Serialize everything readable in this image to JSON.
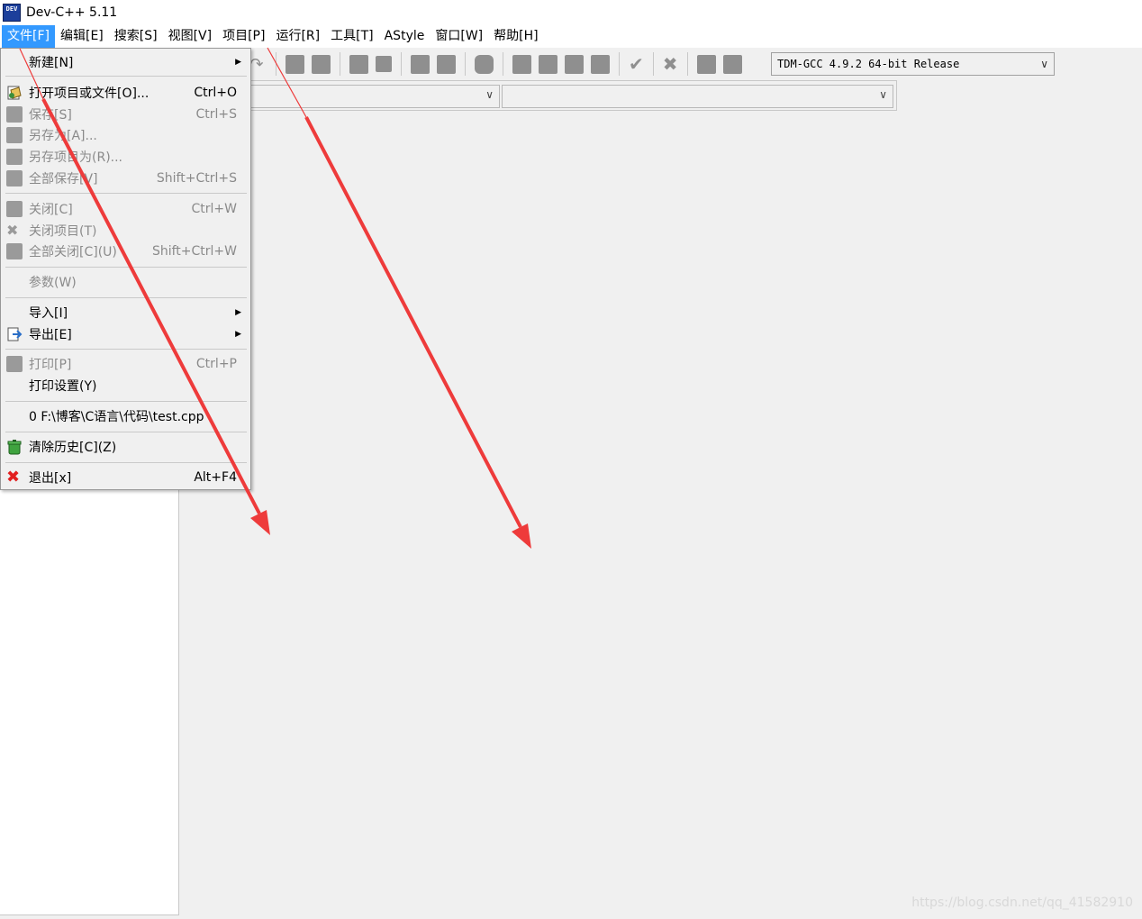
{
  "window": {
    "title": "Dev-C++ 5.11",
    "icon_text": "DEV"
  },
  "menubar": {
    "items": [
      {
        "label": "文件[F]",
        "active": true
      },
      {
        "label": "编辑[E]"
      },
      {
        "label": "搜索[S]"
      },
      {
        "label": "视图[V]"
      },
      {
        "label": "项目[P]"
      },
      {
        "label": "运行[R]"
      },
      {
        "label": "工具[T]"
      },
      {
        "label": "AStyle"
      },
      {
        "label": "窗口[W]"
      },
      {
        "label": "帮助[H]"
      }
    ]
  },
  "toolbar": {
    "compiler": "TDM-GCC 4.9.2 64-bit Release"
  },
  "file_menu": {
    "items": [
      {
        "label": "新建[N]",
        "shortcut": "",
        "submenu": true,
        "disabled": false,
        "icon": ""
      },
      {
        "label": "打开项目或文件[O]...",
        "shortcut": "Ctrl+O",
        "disabled": false,
        "icon": "open-icon"
      },
      {
        "label": "保存[S]",
        "shortcut": "Ctrl+S",
        "disabled": true,
        "icon": "save-icon"
      },
      {
        "label": "另存为[A]...",
        "shortcut": "",
        "disabled": true,
        "icon": "save-as-icon"
      },
      {
        "label": "另存项目为(R)...",
        "shortcut": "",
        "disabled": true,
        "icon": "save-project-icon"
      },
      {
        "label": "全部保存[V]",
        "shortcut": "Shift+Ctrl+S",
        "disabled": true,
        "icon": "save-all-icon"
      },
      {
        "label": "关闭[C]",
        "shortcut": "Ctrl+W",
        "disabled": true,
        "icon": "close-file-icon"
      },
      {
        "label": "关闭项目(T)",
        "shortcut": "",
        "disabled": true,
        "icon": "close-project-icon"
      },
      {
        "label": "全部关闭[C](U)",
        "shortcut": "Shift+Ctrl+W",
        "disabled": true,
        "icon": "close-all-icon"
      },
      {
        "label": "参数(W)",
        "shortcut": "",
        "disabled": true,
        "icon": ""
      },
      {
        "label": "导入[I]",
        "shortcut": "",
        "submenu": true,
        "disabled": false,
        "icon": ""
      },
      {
        "label": "导出[E]",
        "shortcut": "",
        "submenu": true,
        "disabled": false,
        "icon": "export-icon"
      },
      {
        "label": "打印[P]",
        "shortcut": "Ctrl+P",
        "disabled": true,
        "icon": "print-icon"
      },
      {
        "label": "打印设置(Y)",
        "shortcut": "",
        "disabled": false,
        "icon": ""
      },
      {
        "label": "0 F:\\博客\\C语言\\代码\\test.cpp",
        "shortcut": "",
        "disabled": false,
        "icon": ""
      },
      {
        "label": "清除历史[C](Z)",
        "shortcut": "",
        "disabled": false,
        "icon": "trash-icon"
      },
      {
        "label": "退出[x]",
        "shortcut": "Alt+F4",
        "disabled": false,
        "icon": "exit-icon"
      }
    ]
  },
  "watermark": "https://blog.csdn.net/qq_41582910",
  "colors": {
    "menu_active": "#3399ff",
    "arrow": "#ee3b3b"
  }
}
